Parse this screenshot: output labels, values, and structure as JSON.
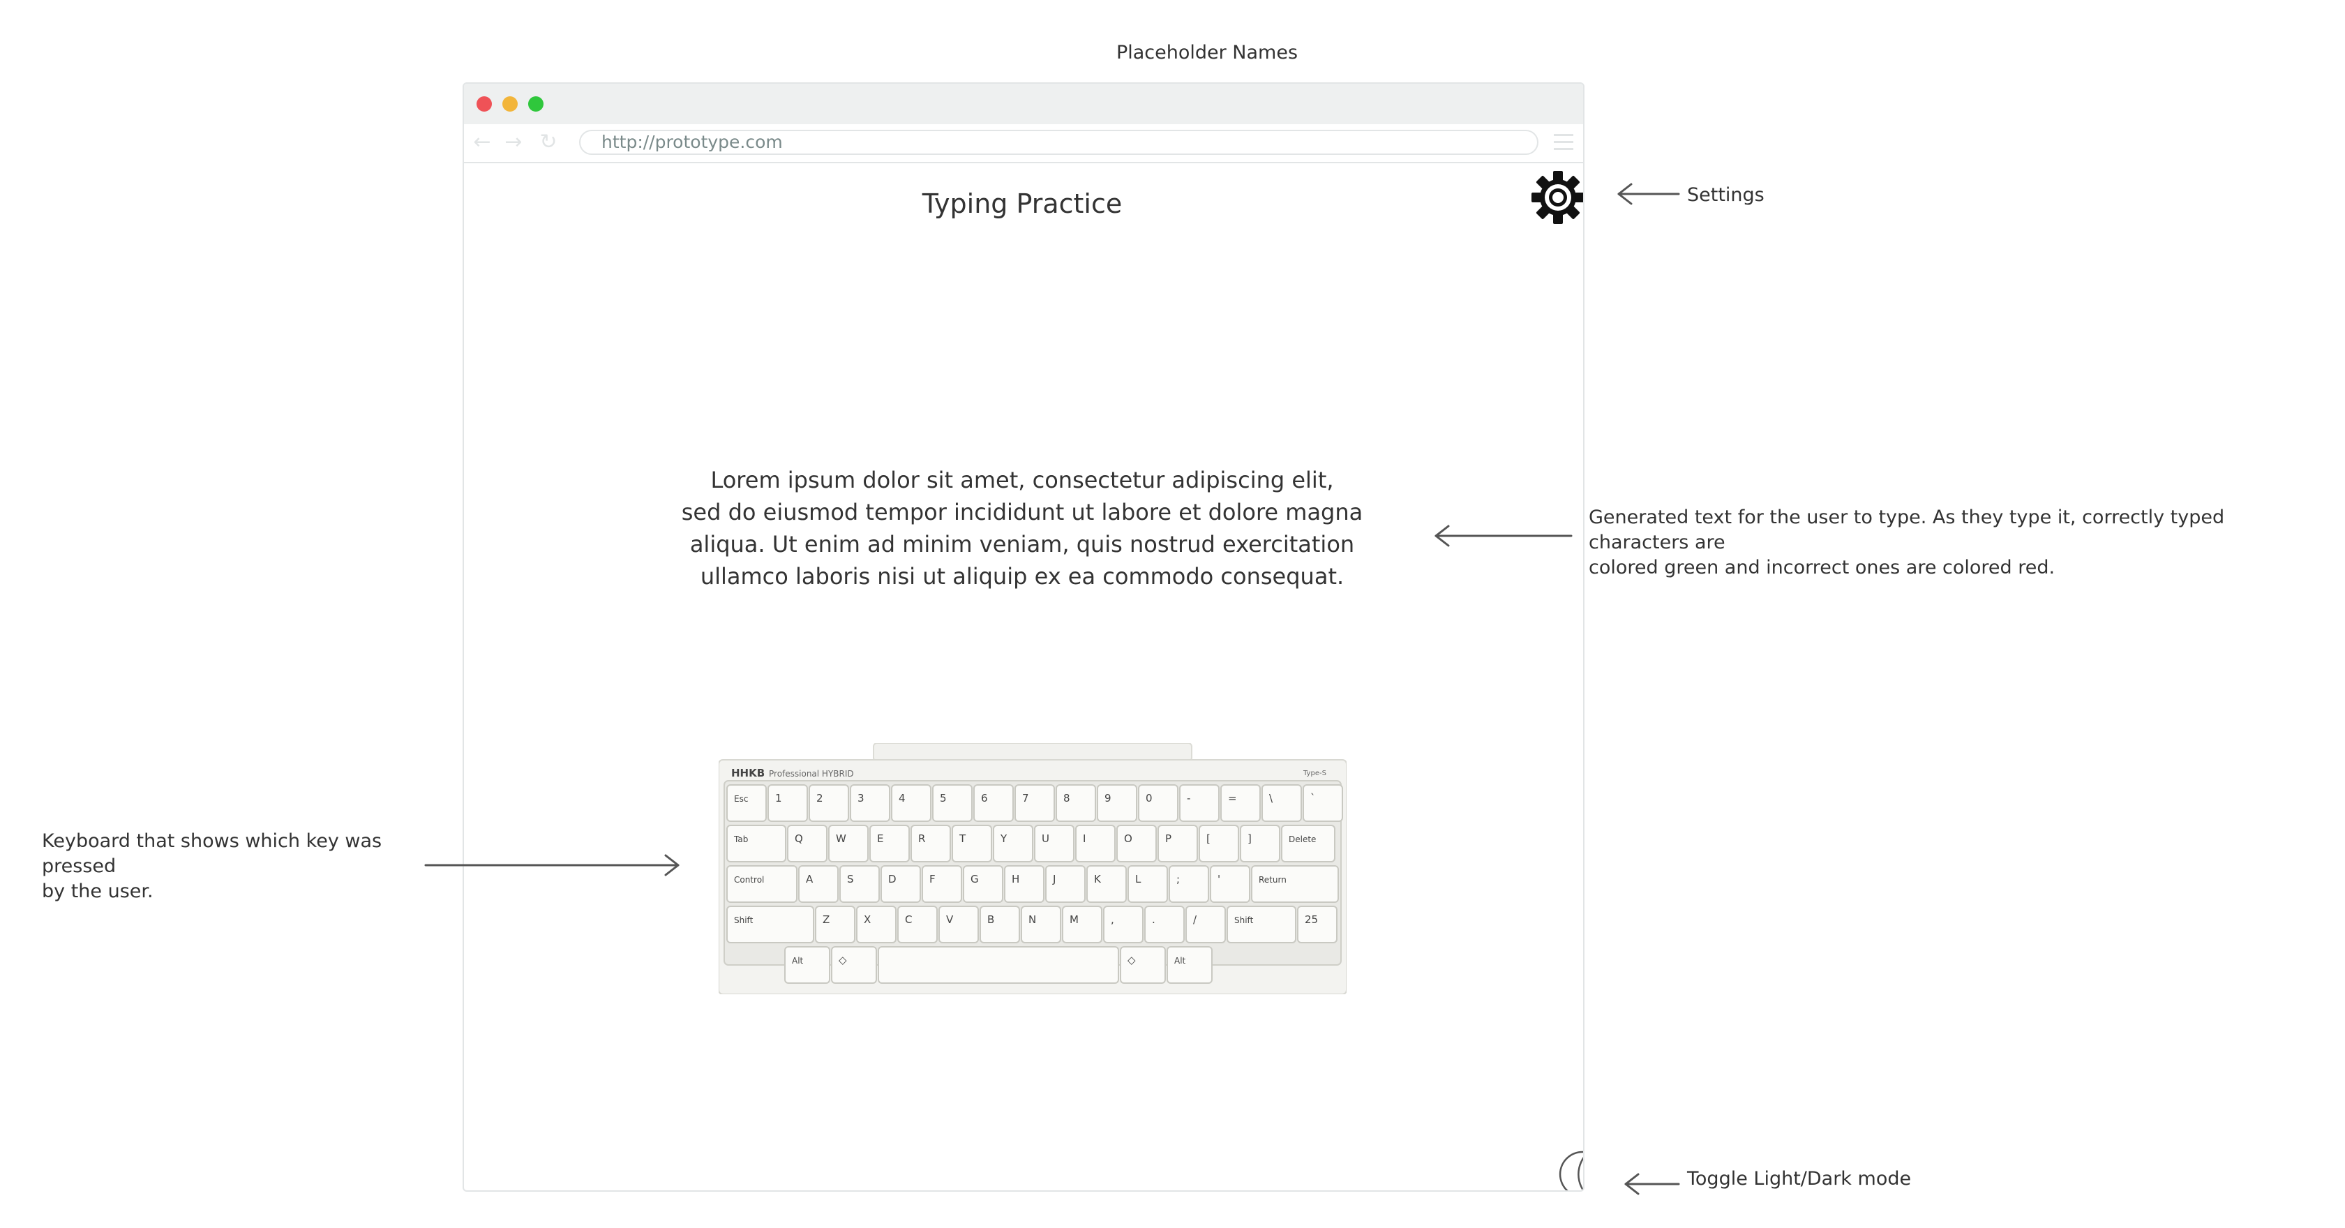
{
  "header": {
    "title": "Placeholder Names"
  },
  "browser": {
    "url": "http://prototype.com"
  },
  "app": {
    "title": "Typing Practice",
    "text_lines": [
      "Lorem ipsum dolor sit amet, consectetur adipiscing elit,",
      "sed do eiusmod tempor incididunt ut labore et dolore magna",
      "aliqua. Ut enim ad minim veniam, quis nostrud exercitation",
      "ullamco laboris nisi ut aliquip ex ea commodo consequat."
    ],
    "keyboard": {
      "brand": "HHKB",
      "model": "Professional HYBRID",
      "type": "Type-S",
      "rows": [
        [
          "Esc",
          "1",
          "2",
          "3",
          "4",
          "5",
          "6",
          "7",
          "8",
          "9",
          "0",
          "-",
          "=",
          "\\",
          "`"
        ],
        [
          "Tab",
          "Q",
          "W",
          "E",
          "R",
          "T",
          "Y",
          "U",
          "I",
          "O",
          "P",
          "[",
          "]",
          "Delete"
        ],
        [
          "Control",
          "A",
          "S",
          "D",
          "F",
          "G",
          "H",
          "J",
          "K",
          "L",
          ";",
          "'",
          "Return"
        ],
        [
          "Shift",
          "Z",
          "X",
          "C",
          "V",
          "B",
          "N",
          "M",
          ",",
          ".",
          "/",
          "Shift",
          "25"
        ],
        [
          "Alt",
          "◇",
          "",
          "◇",
          "Alt"
        ]
      ]
    }
  },
  "annotations": {
    "settings": "Settings",
    "text_line1": "Generated text for the user to type. As they type it, correctly typed characters are",
    "text_line2": "colored green and incorrect ones are colored red.",
    "keyboard_line1": "Keyboard that shows which key was pressed",
    "keyboard_line2": "by the user.",
    "toggle": "Toggle Light/Dark  mode"
  },
  "colors": {
    "window_close": "#ef5257",
    "window_minimize": "#f2b53a",
    "window_maximize": "#2fc73c",
    "text_correct": "green",
    "text_incorrect": "red"
  },
  "icons": [
    "gear-icon",
    "moon-icon",
    "back-icon",
    "forward-icon",
    "reload-icon",
    "menu-icon"
  ]
}
